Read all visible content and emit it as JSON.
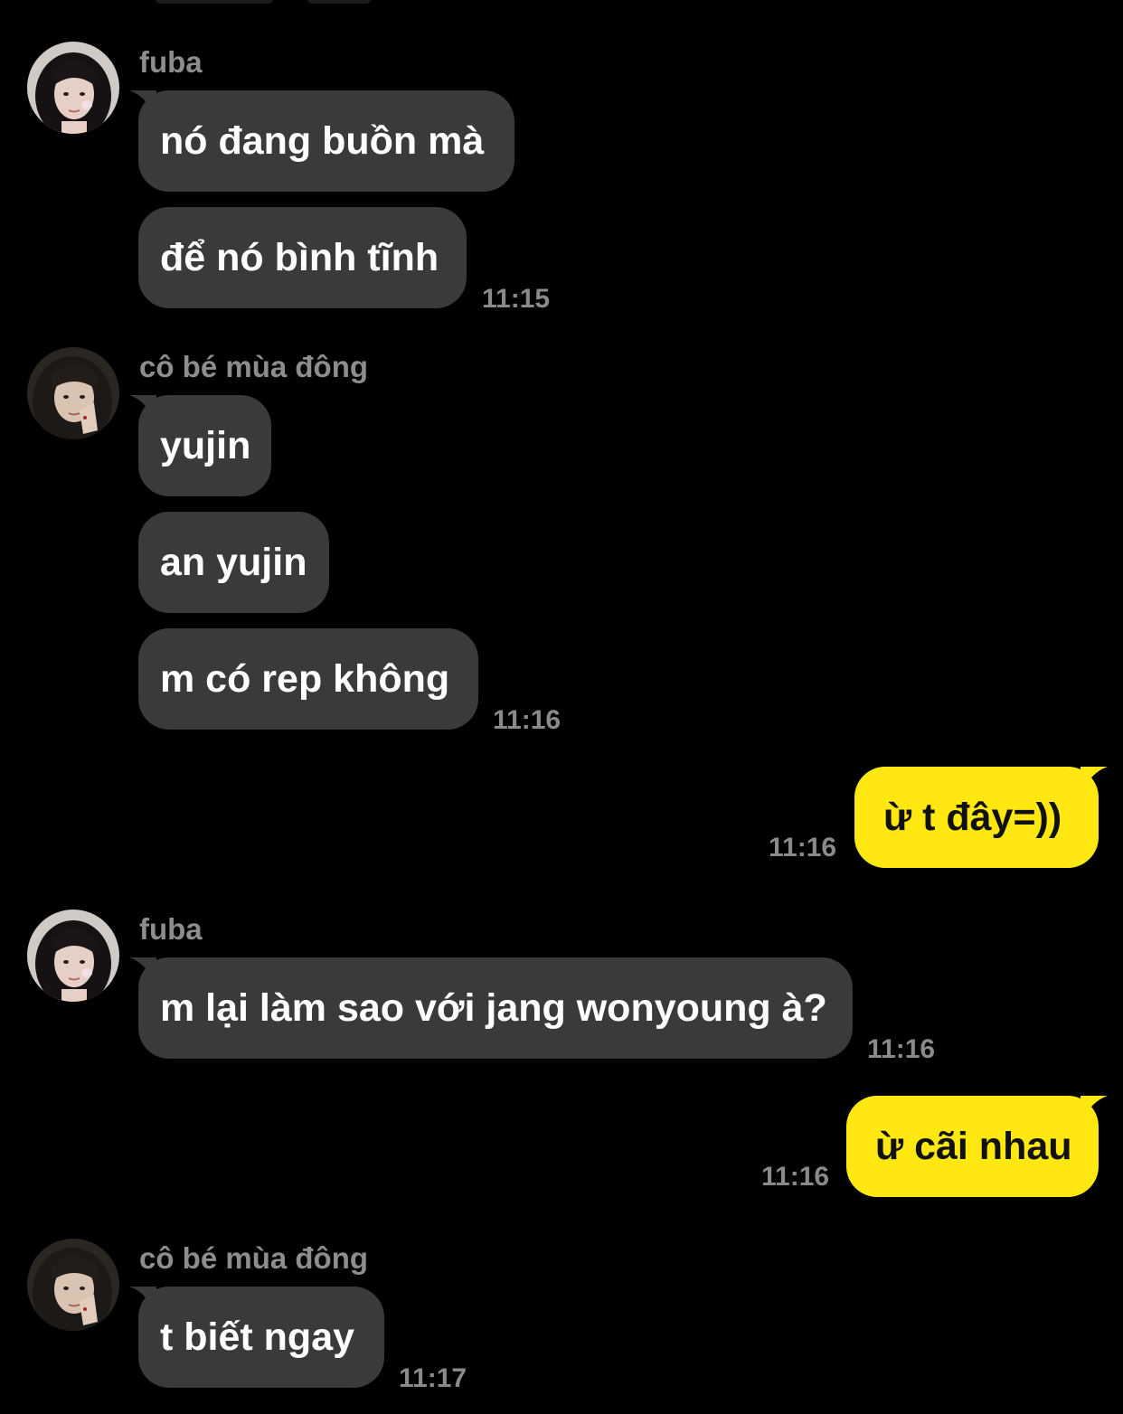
{
  "colors": {
    "background": "#000000",
    "incoming_bubble": "#3a3a3c",
    "outgoing_bubble": "#ffe812",
    "meta_text": "#8d8d8d"
  },
  "groups": [
    {
      "sender": "fuba",
      "avatar": "avatar-fuba",
      "messages": [
        "nó đang buồn mà",
        "để nó bình tĩnh"
      ],
      "time": "11:15"
    },
    {
      "sender": "cô bé mùa đông",
      "avatar": "avatar-co-be-mua-dong",
      "messages": [
        "yujin",
        "an yujin",
        "m có rep không"
      ],
      "time": "11:16"
    },
    {
      "sender": "me",
      "messages": [
        "ừ t đây=))"
      ],
      "time": "11:16"
    },
    {
      "sender": "fuba",
      "avatar": "avatar-fuba",
      "messages": [
        "m lại làm sao với jang wonyoung à?"
      ],
      "time": "11:16"
    },
    {
      "sender": "me",
      "messages": [
        "ừ cãi nhau"
      ],
      "time": "11:16"
    },
    {
      "sender": "cô bé mùa đông",
      "avatar": "avatar-co-be-mua-dong",
      "messages": [
        "t biết ngay"
      ],
      "time": "11:17"
    }
  ]
}
